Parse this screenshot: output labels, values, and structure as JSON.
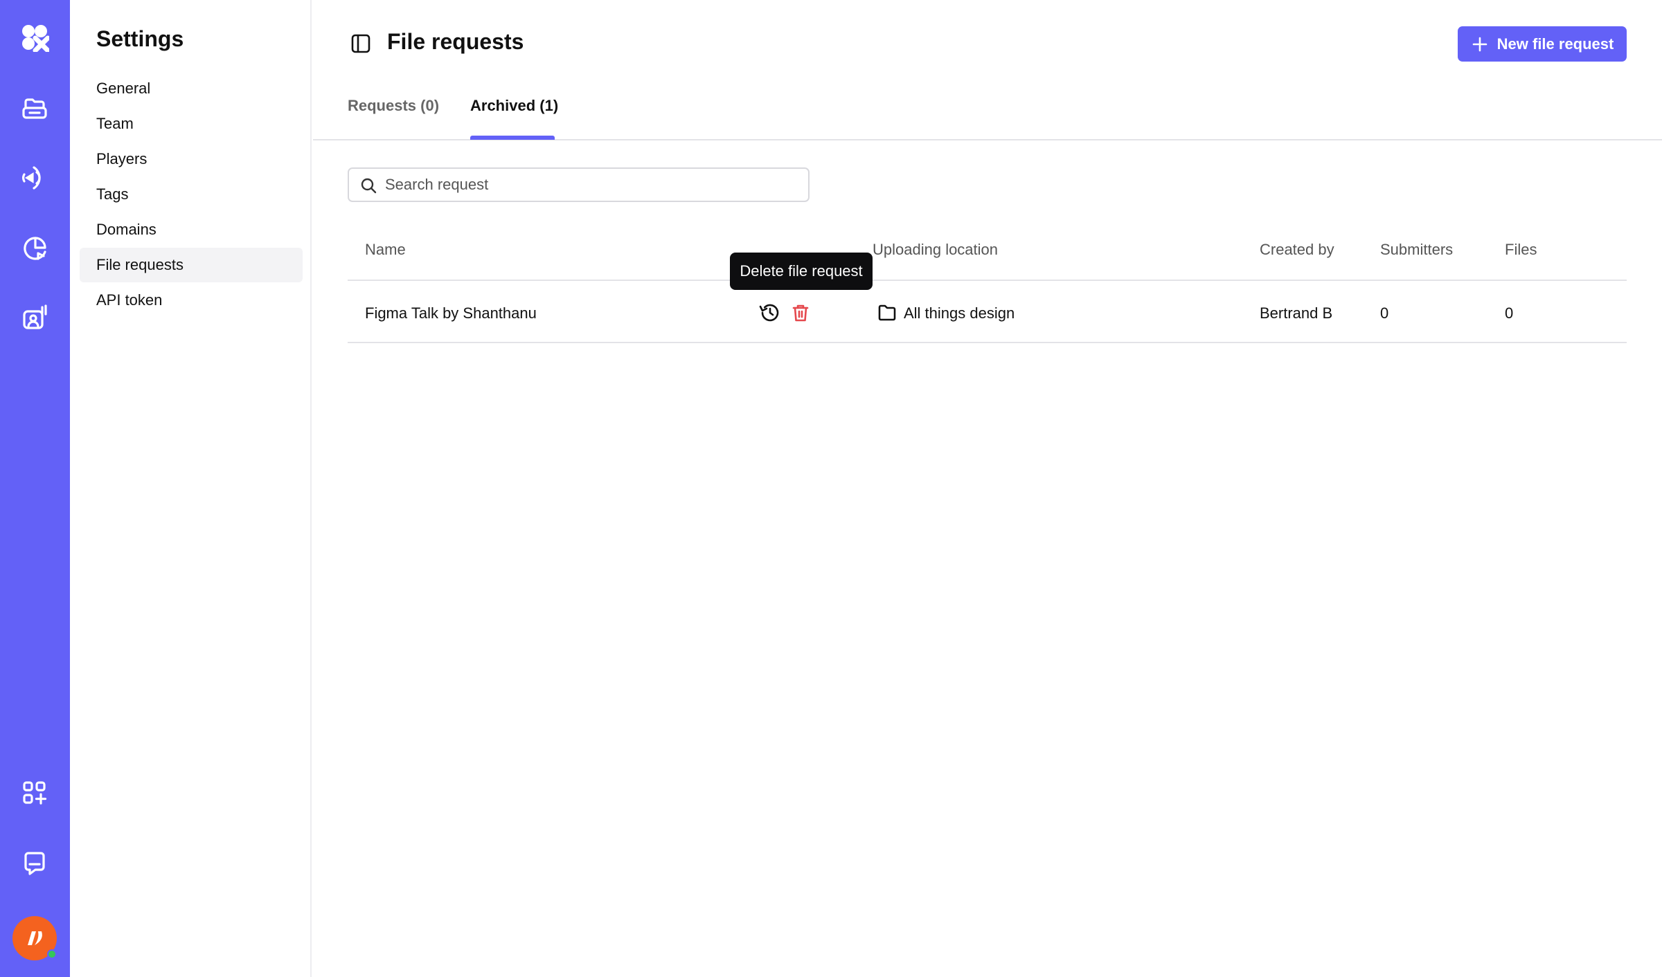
{
  "settings": {
    "title": "Settings",
    "nav": [
      "General",
      "Team",
      "Players",
      "Tags",
      "Domains",
      "File requests",
      "API token"
    ]
  },
  "header": {
    "title": "File requests",
    "new_button": "New file request"
  },
  "tabs": {
    "requests": "Requests (0)",
    "archived": "Archived (1)"
  },
  "search": {
    "placeholder": "Search request"
  },
  "table": {
    "columns": {
      "name": "Name",
      "location": "Uploading location",
      "created_by": "Created by",
      "submitters": "Submitters",
      "files": "Files"
    },
    "rows": [
      {
        "name": "Figma Talk by Shanthanu",
        "location": "All things design",
        "created_by": "Bertrand B",
        "submitters": "0",
        "files": "0"
      }
    ]
  },
  "tooltip": "Delete file request",
  "colors": {
    "accent": "#6361f7",
    "danger": "#e5484d",
    "avatar": "#f4621f"
  },
  "icons": [
    "logo-icon",
    "library-icon",
    "broadcast-icon",
    "analytics-icon",
    "presenter-icon",
    "apps-icon",
    "chat-icon",
    "panel-toggle-icon",
    "plus-icon",
    "search-icon",
    "restore-icon",
    "trash-icon",
    "folder-icon"
  ]
}
